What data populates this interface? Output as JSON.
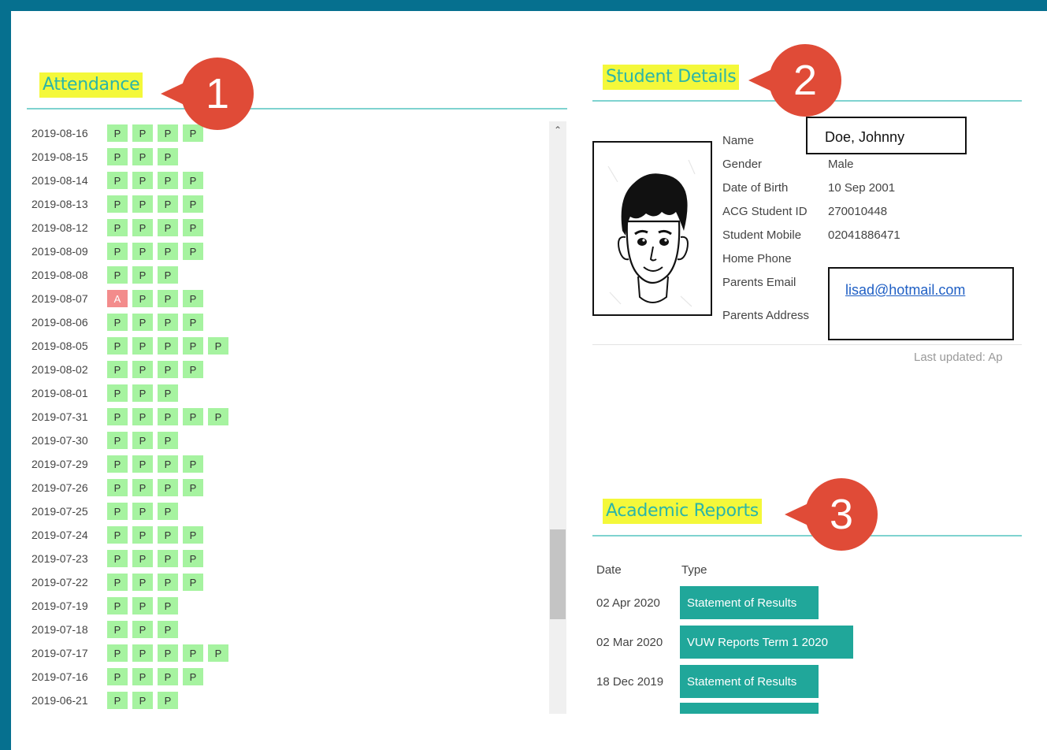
{
  "attendance": {
    "title": "Attendance",
    "rows": [
      {
        "date": "2019-08-16",
        "marks": [
          "P",
          "P",
          "P",
          "P"
        ]
      },
      {
        "date": "2019-08-15",
        "marks": [
          "P",
          "P",
          "P"
        ]
      },
      {
        "date": "2019-08-14",
        "marks": [
          "P",
          "P",
          "P",
          "P"
        ]
      },
      {
        "date": "2019-08-13",
        "marks": [
          "P",
          "P",
          "P",
          "P"
        ]
      },
      {
        "date": "2019-08-12",
        "marks": [
          "P",
          "P",
          "P",
          "P"
        ]
      },
      {
        "date": "2019-08-09",
        "marks": [
          "P",
          "P",
          "P",
          "P"
        ]
      },
      {
        "date": "2019-08-08",
        "marks": [
          "P",
          "P",
          "P"
        ]
      },
      {
        "date": "2019-08-07",
        "marks": [
          "A",
          "P",
          "P",
          "P"
        ]
      },
      {
        "date": "2019-08-06",
        "marks": [
          "P",
          "P",
          "P",
          "P"
        ]
      },
      {
        "date": "2019-08-05",
        "marks": [
          "P",
          "P",
          "P",
          "P",
          "P"
        ]
      },
      {
        "date": "2019-08-02",
        "marks": [
          "P",
          "P",
          "P",
          "P"
        ]
      },
      {
        "date": "2019-08-01",
        "marks": [
          "P",
          "P",
          "P"
        ]
      },
      {
        "date": "2019-07-31",
        "marks": [
          "P",
          "P",
          "P",
          "P",
          "P"
        ]
      },
      {
        "date": "2019-07-30",
        "marks": [
          "P",
          "P",
          "P"
        ]
      },
      {
        "date": "2019-07-29",
        "marks": [
          "P",
          "P",
          "P",
          "P"
        ]
      },
      {
        "date": "2019-07-26",
        "marks": [
          "P",
          "P",
          "P",
          "P"
        ]
      },
      {
        "date": "2019-07-25",
        "marks": [
          "P",
          "P",
          "P"
        ]
      },
      {
        "date": "2019-07-24",
        "marks": [
          "P",
          "P",
          "P",
          "P"
        ]
      },
      {
        "date": "2019-07-23",
        "marks": [
          "P",
          "P",
          "P",
          "P"
        ]
      },
      {
        "date": "2019-07-22",
        "marks": [
          "P",
          "P",
          "P",
          "P"
        ]
      },
      {
        "date": "2019-07-19",
        "marks": [
          "P",
          "P",
          "P"
        ]
      },
      {
        "date": "2019-07-18",
        "marks": [
          "P",
          "P",
          "P"
        ]
      },
      {
        "date": "2019-07-17",
        "marks": [
          "P",
          "P",
          "P",
          "P",
          "P"
        ]
      },
      {
        "date": "2019-07-16",
        "marks": [
          "P",
          "P",
          "P",
          "P"
        ]
      },
      {
        "date": "2019-06-21",
        "marks": [
          "P",
          "P",
          "P"
        ]
      }
    ]
  },
  "student_details": {
    "title": "Student Details",
    "labels": {
      "name": "Name",
      "gender": "Gender",
      "dob": "Date of Birth",
      "student_id": "ACG Student ID",
      "mobile": "Student Mobile",
      "home_phone": "Home Phone",
      "parents_email": "Parents Email",
      "parents_address": "Parents Address"
    },
    "values": {
      "name": "Doe, Johnny",
      "gender": "Male",
      "dob": "10 Sep 2001",
      "student_id": "270010448",
      "mobile": "02041886471",
      "parents_email": "lisad@hotmail.com"
    },
    "last_updated": "Last updated: Ap"
  },
  "academic_reports": {
    "title": "Academic Reports",
    "headers": {
      "date": "Date",
      "type": "Type"
    },
    "rows": [
      {
        "date": "02 Apr 2020",
        "type": "Statement of Results"
      },
      {
        "date": "02 Mar 2020",
        "type": "VUW Reports Term 1 2020"
      },
      {
        "date": "18 Dec 2019",
        "type": "Statement of Results"
      }
    ]
  },
  "callouts": {
    "one": "1",
    "two": "2",
    "three": "3"
  },
  "colors": {
    "frame": "#06708f",
    "present": "#a6f3a0",
    "absent": "#f38c8c",
    "accent": "#20a79a",
    "highlight": "#f4f83a",
    "callout": "#e04b37"
  }
}
